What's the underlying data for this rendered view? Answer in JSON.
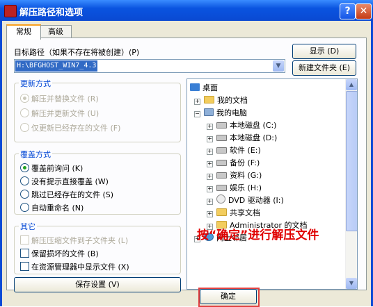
{
  "window": {
    "title": "解压路径和选项",
    "help_glyph": "?",
    "close_glyph": "✕",
    "icon": "winrar-icon"
  },
  "tabs": [
    {
      "label": "常规",
      "active": true
    },
    {
      "label": "高级",
      "active": false
    }
  ],
  "target_path": {
    "label": "目标路径（如果不存在将被创建）(P)",
    "value": "H:\\BFGHOST_WIN7_4.3",
    "show_button": "显示 (D)",
    "new_folder_button": "新建文件夹 (E)"
  },
  "update_mode": {
    "title": "更新方式",
    "options": [
      {
        "label": "解压并替换文件 (R)",
        "selected": true
      },
      {
        "label": "解压并更新文件 (U)",
        "selected": false
      },
      {
        "label": "仅更新已经存在的文件 (F)",
        "selected": false
      }
    ]
  },
  "overwrite_mode": {
    "title": "覆盖方式",
    "options": [
      {
        "label": "覆盖前询问 (K)",
        "selected": true
      },
      {
        "label": "没有提示直接覆盖 (W)",
        "selected": false
      },
      {
        "label": "跳过已经存在的文件 (S)",
        "selected": false
      },
      {
        "label": "自动重命名 (N)",
        "selected": false
      }
    ]
  },
  "misc": {
    "title": "其它",
    "options": [
      {
        "label": "解压压缩文件到子文件夹 (L)",
        "checked": false
      },
      {
        "label": "保留损坏的文件 (B)",
        "checked": false
      },
      {
        "label": "在资源管理器中显示文件 (X)",
        "checked": false
      }
    ]
  },
  "save_settings_button": "保存设置 (V)",
  "tree": [
    {
      "label": "桌面",
      "icon": "desktop-icon",
      "expander": ""
    },
    {
      "label": "我的文档",
      "icon": "folder-icon",
      "expander": "+"
    },
    {
      "label": "我的电脑",
      "icon": "computer-icon",
      "expander": "−"
    },
    {
      "label": "本地磁盘  (C:)",
      "icon": "drive-icon",
      "expander": "+"
    },
    {
      "label": "本地磁盘  (D:)",
      "icon": "drive-icon",
      "expander": "+"
    },
    {
      "label": "软件  (E:)",
      "icon": "drive-icon",
      "expander": "+"
    },
    {
      "label": "备份  (F:)",
      "icon": "drive-icon",
      "expander": "+"
    },
    {
      "label": "资料  (G:)",
      "icon": "drive-icon",
      "expander": "+"
    },
    {
      "label": "娱乐  (H:)",
      "icon": "drive-icon",
      "expander": "+"
    },
    {
      "label": "DVD 驱动器  (I:)",
      "icon": "dvd-icon",
      "expander": "+"
    },
    {
      "label": "共享文档",
      "icon": "folder-icon",
      "expander": "+"
    },
    {
      "label": "Administrator 的文档",
      "icon": "folder-icon",
      "expander": "+"
    },
    {
      "label": "网上邻居",
      "icon": "network-icon",
      "expander": "+"
    }
  ],
  "annotation": "按“确定”进行解压文件",
  "ok_button": "确定"
}
